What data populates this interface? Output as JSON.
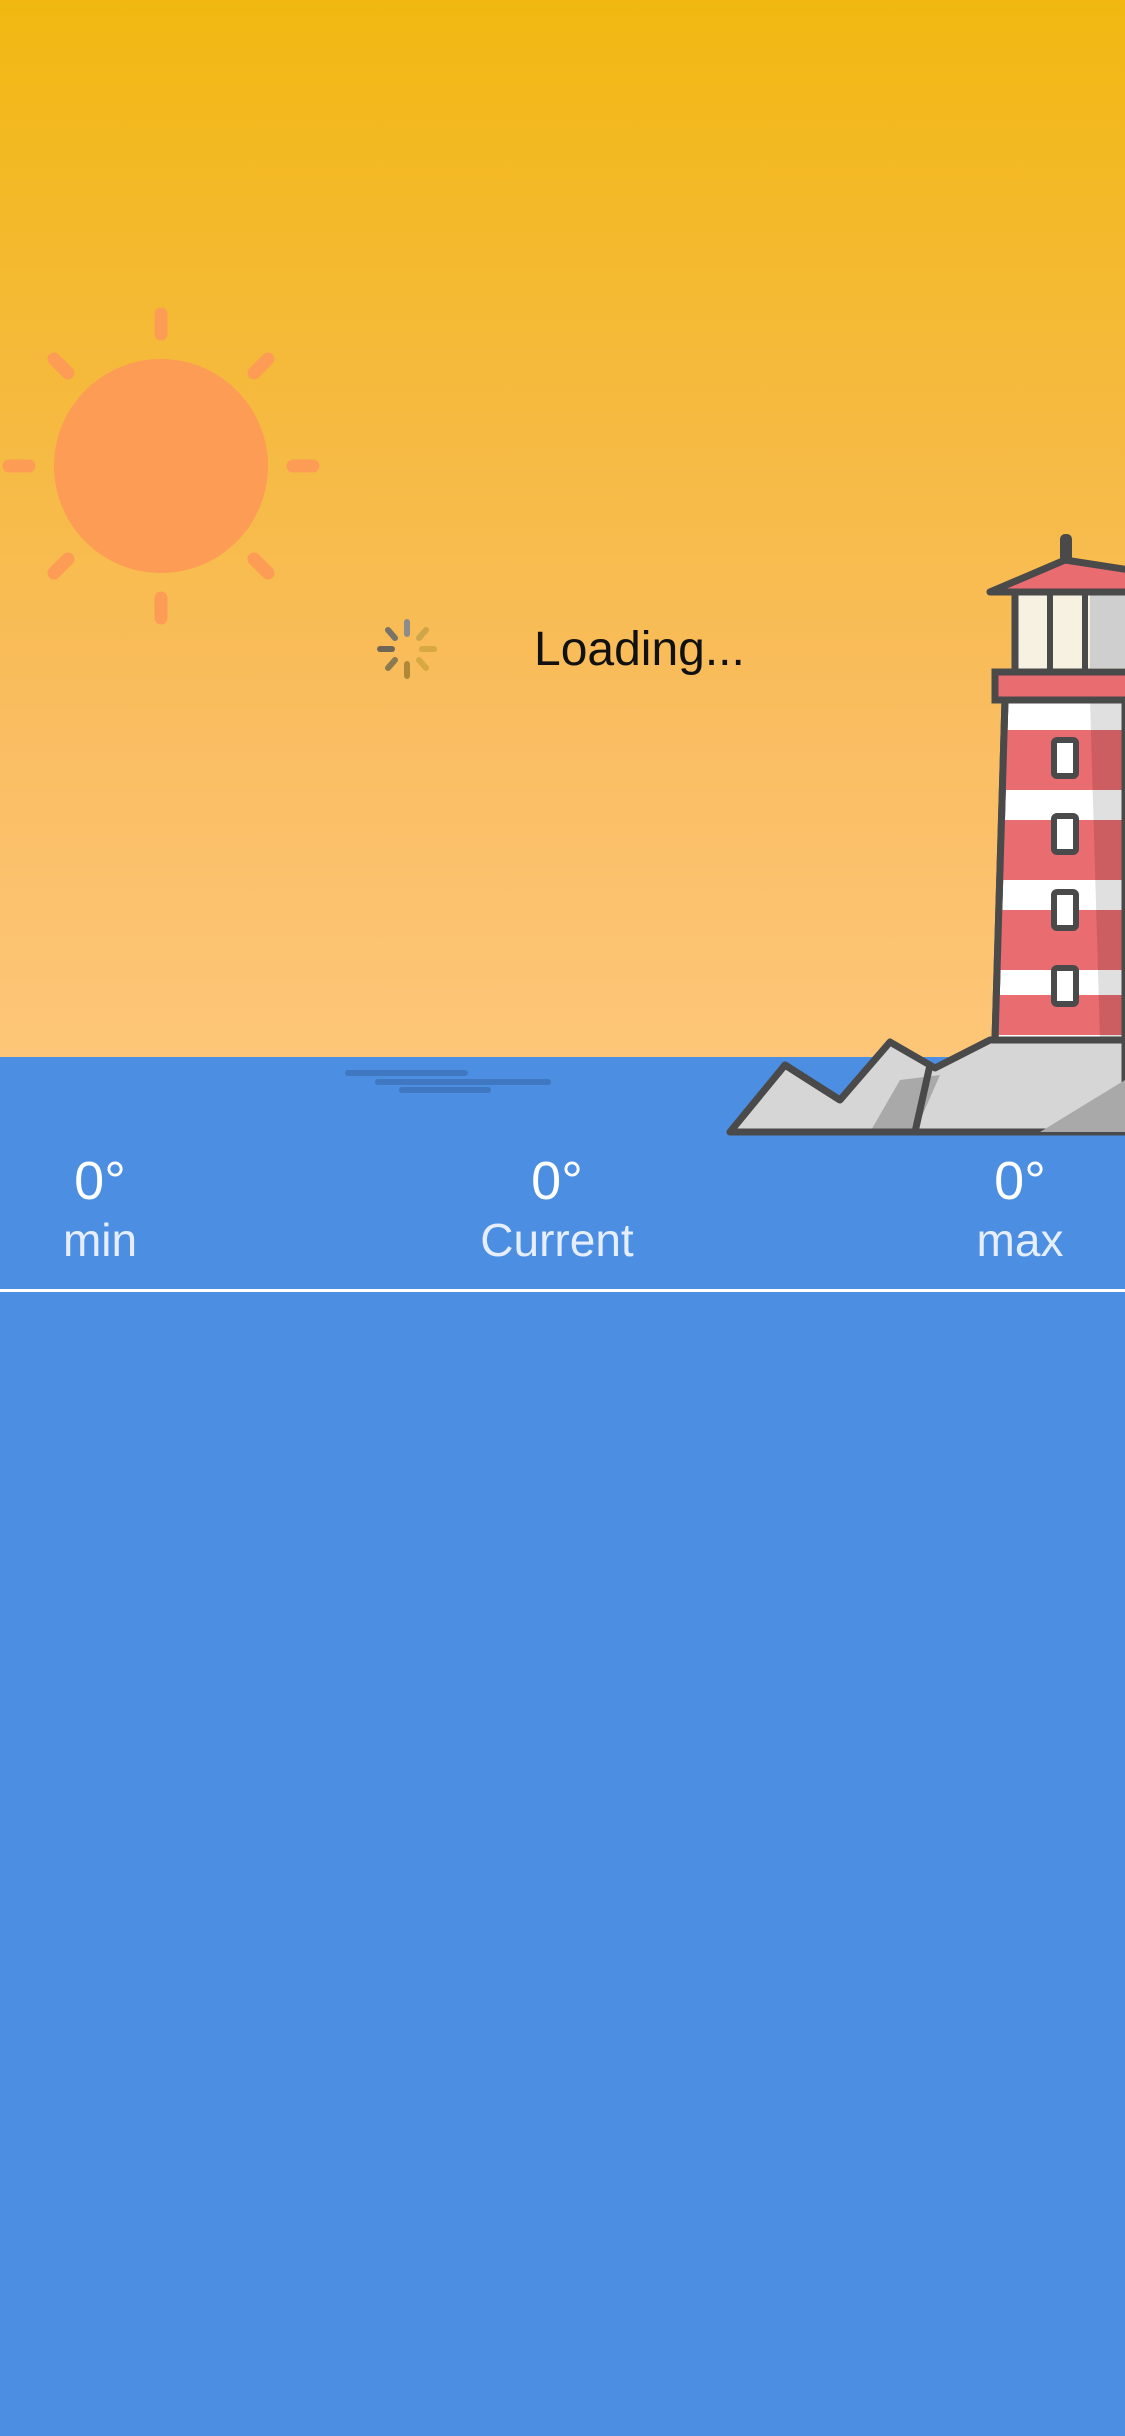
{
  "loading": {
    "text": "Loading..."
  },
  "temperatures": {
    "min": {
      "value": "0°",
      "label": "min"
    },
    "current": {
      "value": "0°",
      "label": "Current"
    },
    "max": {
      "value": "0°",
      "label": "max"
    }
  },
  "colors": {
    "sky_top": "#f2b811",
    "sky_bottom": "#fdc678",
    "sea": "#4b8ee2",
    "sun": "#fd9c55",
    "lighthouse_red": "#e96c70",
    "rock": "#d9d9d9"
  },
  "icons": {
    "sun": "sun-icon",
    "lighthouse": "lighthouse-icon",
    "spinner": "activity-spinner-icon"
  }
}
